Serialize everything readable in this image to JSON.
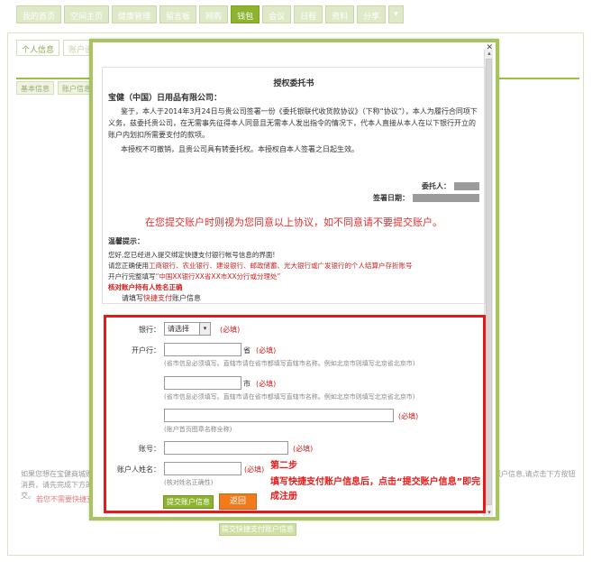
{
  "nav": {
    "tabs": [
      "我的首页",
      "空间主页",
      "健康管理",
      "留言板",
      "网购",
      "钱包",
      "会议",
      "日程",
      "资料",
      "分享"
    ],
    "more": "▾"
  },
  "subnav": {
    "tabs": [
      "个人信息",
      "账户设置"
    ],
    "section_tabs": [
      "基本信息",
      "账户信息"
    ]
  },
  "background": {
    "note_left": "如果您想在宝健商城购物消费，请先完成下方的提交。",
    "note_red": "若您不需要快捷支付",
    "note_right": "账户信息,请点击下方按钮",
    "bottom_button": "提交快捷支付账户信息"
  },
  "modal": {
    "close": "✕",
    "scroll_up": "▴",
    "scroll_down": "▾"
  },
  "letter": {
    "title": "授权委托书",
    "recipient": "宝健（中国）日用品有限公司：",
    "paragraph1": "鉴于，本人于2014年3月24日与贵公司签署一份《委托银联代收货款协议》（下称“协议”），本人为履行合同项下义务，兹委托贵公司，在无需事先征得本人同意且无需本人发出指令的情况下，代本人直接从本人在以下银行开立的账户内划扣所需要支付的款项。",
    "paragraph2": "本授权不可撤销，且贵公司具有转委托权。本授权自本人签署之日起生效。",
    "principal_label": "委托人：",
    "date_label": "签署日期：",
    "warning": "在您提交账户时则视为您同意以上协议，如不同意请不要提交账户。"
  },
  "tips": {
    "title": "温馨提示：",
    "line1": "您好,您已经进入提交绑定快捷支付银行帐号信息的界面!",
    "line2_prefix": "请您正确使用",
    "line2_banks": "工商银行、农业银行、建设银行、邮政储蓄、光大银行或广发银行的个人结算户存折账号",
    "line3_prefix": "开户行完整填写",
    "line3_example": "“中国XX银行XX省XX市XX分行或分理处”",
    "line4": "核对账户持有人姓名正确"
  },
  "form": {
    "fill_hint_prefix": "请填写",
    "fill_hint_link": "快捷支付",
    "fill_hint_suffix": "账户信息",
    "bank_label": "银行：",
    "bank_value": "请选择",
    "select_arrow": "▾",
    "required": "(必填)",
    "branch_label": "开户行：",
    "province_unit": "省",
    "province_hint": "(省市信息必须填写。直辖市请在省市都填写直辖市名称。例如北京市则填写北京省北京市)",
    "city_unit": "市",
    "city_hint": "(省市信息必须填写。直辖市请在省市都填写直辖市名称。例如北京市则填写北京省北京市)",
    "branch_hint": "(账户首页图章名称全称)",
    "account_label": "账号：",
    "holder_label": "账户人姓名：",
    "holder_hint": "(核对姓名正确性)",
    "submit_label": "提交账户信息",
    "back_label": "返回"
  },
  "annotation": {
    "step": "第二步",
    "description": "填写快捷支付账户信息后，点击“提交账户信息”即完成注册"
  }
}
